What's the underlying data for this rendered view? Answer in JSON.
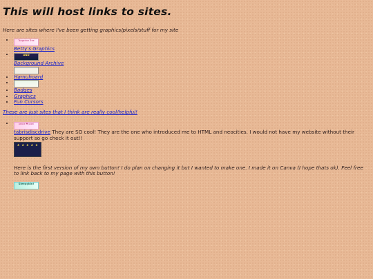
{
  "page": {
    "title": "This will host links to sites.",
    "intro": "Here are sites where I've been getting graphics/pixels/stuff for my site"
  },
  "graphics_sites": [
    {
      "button_text": "Tangerine Tree",
      "link": "Betty's Graphics"
    },
    {
      "button_text": "AND",
      "link": "Background Archive"
    },
    {
      "button_text": "",
      "link": "Hamuhoard"
    },
    {
      "button_text": "",
      "link": ""
    }
  ],
  "extra_links": [
    "Badges",
    "Graphics",
    "Fun Cursors"
  ],
  "cool_sites_link": "These are just sites that I think are really cool/helpful!",
  "cool_sites": [
    {
      "button_text": "peace ♥ pixel",
      "link": "tabrisdiscdrive",
      "description": "They are SO cool! They are the one who introduced me to HTML and neocities. I would not have my website without their support so go check it out!!"
    }
  ],
  "stars_button_text": "★ ★ ★ ★ ★",
  "own_button_note": "Here is the first version of my own button! I do plan on changing it but I wanted to make one. I made it on Canva (I hope thats ok). Feel free to link back to my page with this button!",
  "own_button_text": "Sleepykin!",
  "colors": {
    "background": "#e8b996",
    "link": "#1a22c8",
    "text": "#2a1a1a"
  }
}
